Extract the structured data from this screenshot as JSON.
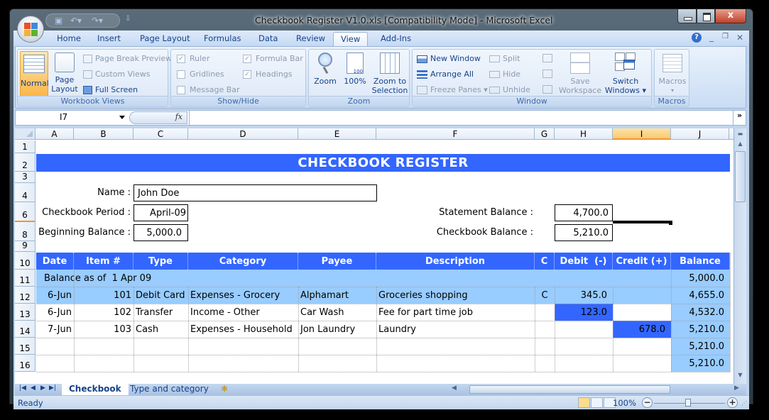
{
  "window": {
    "title": "Checkbook Register V1.0.xls  [Compatibility Mode] - Microsoft Excel",
    "close_label": "x"
  },
  "ribbon_tabs": [
    "Home",
    "Insert",
    "Page Layout",
    "Formulas",
    "Data",
    "Review",
    "View",
    "Add-Ins"
  ],
  "active_tab": "View",
  "ribbon": {
    "workbook_views": {
      "label": "Workbook Views",
      "normal": "Normal",
      "page_layout": [
        "Page",
        "Layout"
      ],
      "page_break_preview": "Page Break Preview",
      "custom_views": "Custom Views",
      "full_screen": "Full Screen"
    },
    "show_hide": {
      "label": "Show/Hide",
      "ruler": {
        "label": "Ruler",
        "checked": true
      },
      "gridlines": {
        "label": "Gridlines",
        "checked": false
      },
      "message_bar": {
        "label": "Message Bar",
        "checked": false
      },
      "formula_bar": {
        "label": "Formula Bar",
        "checked": true
      },
      "headings": {
        "label": "Headings",
        "checked": true
      }
    },
    "zoom": {
      "label": "Zoom",
      "zoom": "Zoom",
      "hundred": "100%",
      "zoom_to_selection": [
        "Zoom to",
        "Selection"
      ]
    },
    "window": {
      "label": "Window",
      "new_window": "New Window",
      "arrange_all": "Arrange All",
      "freeze_panes": "Freeze Panes",
      "split": "Split",
      "hide": "Hide",
      "unhide": "Unhide",
      "save_workspace": [
        "Save",
        "Workspace"
      ],
      "switch_windows": [
        "Switch",
        "Windows"
      ]
    },
    "macros": {
      "label": "Macros",
      "macros": "Macros"
    }
  },
  "formula_bar": {
    "name_box": "I7",
    "fx": "fx",
    "formula": ""
  },
  "columns": [
    "A",
    "B",
    "C",
    "D",
    "E",
    "F",
    "G",
    "H",
    "I",
    "J"
  ],
  "selected_column": "I",
  "rows": [
    "1",
    "2",
    "3",
    "4",
    "6",
    "8",
    "9",
    "10",
    "11",
    "12",
    "13",
    "14",
    "15",
    "16"
  ],
  "sheet": {
    "title": "CHECKBOOK REGISTER",
    "name_label": "Name :",
    "name_value": "John Doe",
    "period_label": "Checkbook Period :",
    "period_value": "April-09",
    "beginning_label": "Beginning Balance :",
    "beginning_value": "5,000.0",
    "statement_label": "Statement Balance :",
    "statement_value": "4,700.0",
    "checkbook_label": "Checkbook Balance :",
    "checkbook_value": "5,210.0",
    "table_headers": [
      "Date",
      "Item #",
      "Type",
      "Category",
      "Payee",
      "Description",
      "C",
      "Debit  (-)",
      "Credit (+)",
      "Balance"
    ],
    "opening_row": {
      "label": "Balance as of  1 Apr 09",
      "balance": "5,000.0"
    },
    "transactions": [
      {
        "date": "6-Jun",
        "item": "101",
        "type": "Debit Card",
        "category": "Expenses - Grocery",
        "payee": "Alphamart",
        "description": "Groceries shopping",
        "c": "C",
        "debit": "345.0",
        "credit": "",
        "balance": "4,655.0"
      },
      {
        "date": "6-Jun",
        "item": "102",
        "type": "Transfer",
        "category": "Income - Other",
        "payee": "Car Wash",
        "description": "Fee for part time job",
        "c": "",
        "debit": "123.0",
        "credit": "",
        "balance": "4,532.0"
      },
      {
        "date": "7-Jun",
        "item": "103",
        "type": "Cash",
        "category": "Expenses - Household",
        "payee": "Jon Laundry",
        "description": "Laundry",
        "c": "",
        "debit": "",
        "credit": "678.0",
        "balance": "5,210.0"
      }
    ],
    "empty_rows_balance": [
      "5,210.0",
      "5,210.0"
    ]
  },
  "sheet_tabs": [
    "Checkbook",
    "Type and category"
  ],
  "active_sheet": "Checkbook",
  "status": {
    "ready": "Ready",
    "zoom": "100%"
  },
  "colors": {
    "header_blue": "#3366ff",
    "light_blue": "#99ccff",
    "selected_col": "#f8c972"
  }
}
